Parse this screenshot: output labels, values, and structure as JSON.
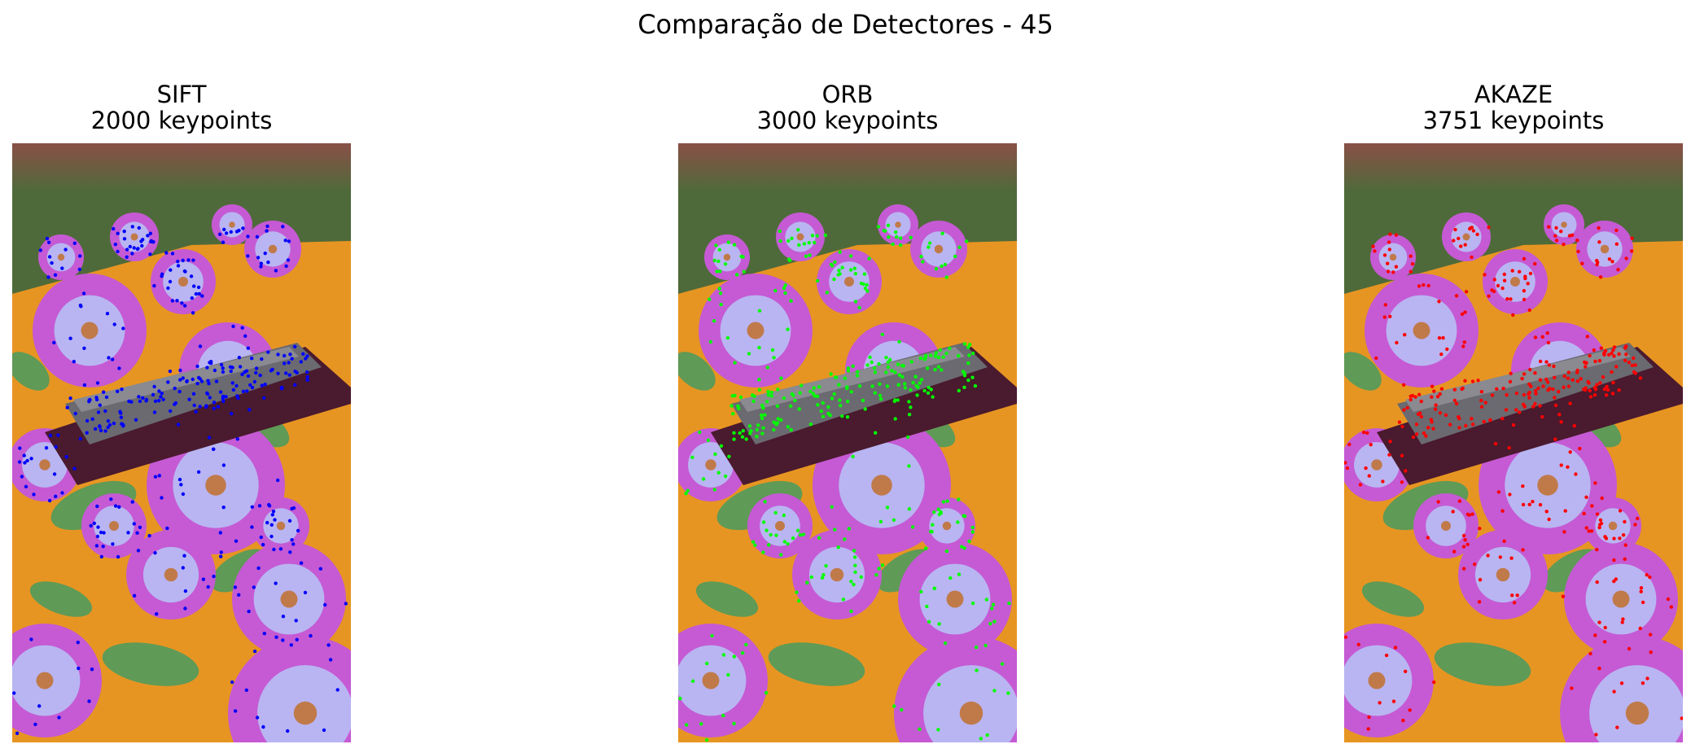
{
  "figure": {
    "title": "Comparação de Detectores - 45"
  },
  "panels": [
    {
      "detector": "SIFT",
      "count_label": "2000 keypoints",
      "keypoints": 2000,
      "keypoint_color": "#0000ff"
    },
    {
      "detector": "ORB",
      "count_label": "3000 keypoints",
      "keypoints": 3000,
      "keypoint_color": "#00ff00"
    },
    {
      "detector": "AKAZE",
      "count_label": "3751 keypoints",
      "keypoints": 3751,
      "keypoint_color": "#ff0000"
    }
  ],
  "photo": {
    "subject": "model cruise ship on a floral tablecloth",
    "colors": {
      "grass": "#4f6a3a",
      "brick": "#8a5048",
      "tablecloth": "#e79522",
      "flower_petal": "#c55ad4",
      "flower_light": "#b9b5f2",
      "leaf": "#5f9a56",
      "ship_base": "#4a1a2e",
      "ship_hull": "#6a6a70"
    }
  }
}
